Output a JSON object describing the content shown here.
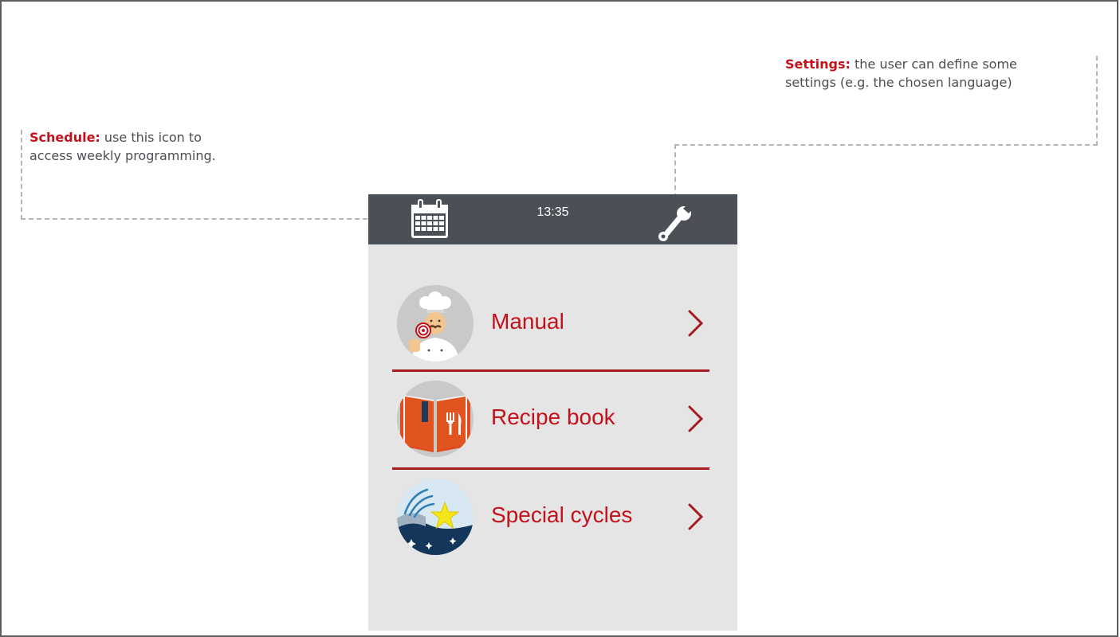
{
  "annotations": {
    "schedule": {
      "title": "Schedule:",
      "text": " use this icon to access weekly programming."
    },
    "settings": {
      "title": "Settings:",
      "text": " the user can define some settings (e.g. the chosen language)"
    }
  },
  "device": {
    "clock": "13:35",
    "icons": {
      "schedule": "calendar-icon",
      "settings": "wrench-icon"
    },
    "menu": [
      {
        "label": "Manual",
        "icon": "chef-icon"
      },
      {
        "label": "Recipe book",
        "icon": "recipe-book-icon"
      },
      {
        "label": "Special cycles",
        "icon": "special-cycles-icon"
      }
    ]
  },
  "colors": {
    "accent": "#c3121c",
    "topbar": "#4b5057",
    "screen": "#e5e5e5",
    "separator": "#a61b1f"
  }
}
